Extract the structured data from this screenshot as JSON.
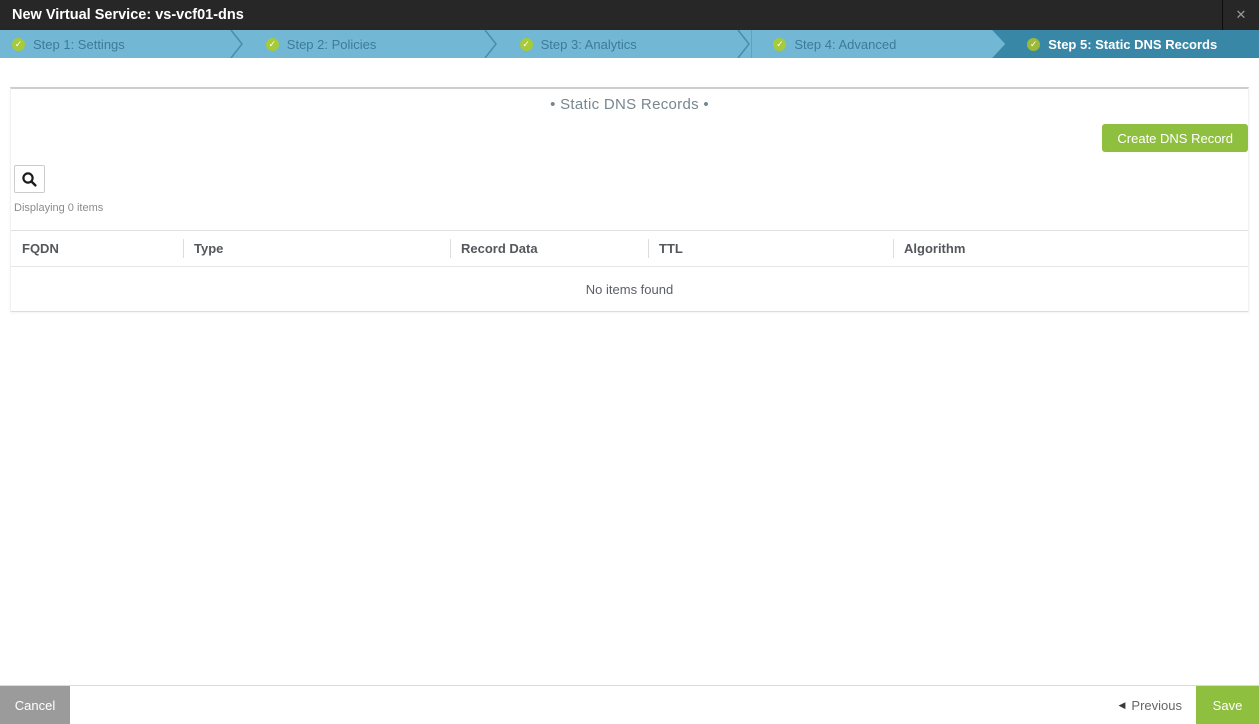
{
  "titlebar": {
    "title": "New Virtual Service: vs-vcf01-dns",
    "close_glyph": "✕"
  },
  "steps": [
    {
      "label": "Step 1: Settings",
      "state": "complete"
    },
    {
      "label": "Step 2: Policies",
      "state": "complete"
    },
    {
      "label": "Step 3: Analytics",
      "state": "complete"
    },
    {
      "label": "Step 4: Advanced",
      "state": "complete"
    },
    {
      "label": "Step 5: Static DNS Records",
      "state": "active"
    }
  ],
  "icons": {
    "check_glyph": "✓",
    "previous_arrow_glyph": "◀"
  },
  "content": {
    "section_title": "• Static DNS Records •",
    "create_button_label": "Create DNS Record",
    "displaying_text": "Displaying 0 items",
    "table": {
      "columns": [
        "FQDN",
        "Type",
        "Record Data",
        "TTL",
        "Algorithm"
      ],
      "rows": [],
      "empty_text": "No items found"
    }
  },
  "footer": {
    "cancel_label": "Cancel",
    "previous_label": "Previous",
    "save_label": "Save"
  },
  "colors": {
    "titlebar_dark": "#272727",
    "step_bar_blue": "#72b8d5",
    "step_active_blue": "#3987a6",
    "check_green": "#a6ca3a",
    "accent_green": "#8fbf3f",
    "cancel_gray": "#9b9b9b"
  }
}
